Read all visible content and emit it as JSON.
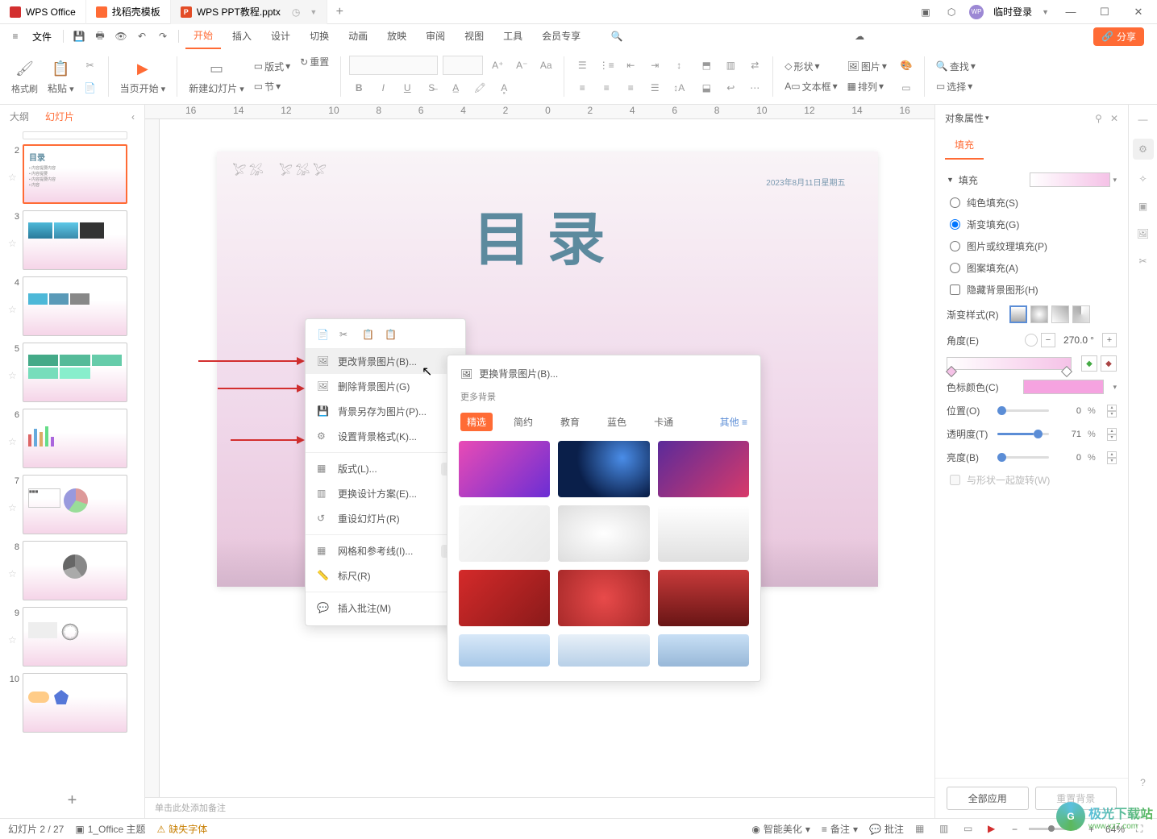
{
  "titlebar": {
    "tabs": [
      {
        "icon": "wps-logo",
        "label": "WPS Office"
      },
      {
        "icon": "doc-icon",
        "label": "找稻壳模板"
      },
      {
        "icon": "ppt-icon",
        "label": "WPS PPT教程.pptx",
        "active": true
      }
    ],
    "login": "临时登录"
  },
  "menubar": {
    "file": "文件",
    "items": [
      "开始",
      "插入",
      "设计",
      "切换",
      "动画",
      "放映",
      "审阅",
      "视图",
      "工具",
      "会员专享"
    ],
    "active": "开始",
    "share": "分享"
  },
  "toolbar": {
    "format_painter": "格式刷",
    "paste": "粘贴",
    "current_page": "当页开始",
    "new_slide": "新建幻灯片",
    "layout": "版式",
    "sections": "节",
    "reset": "重置",
    "shape": "形状",
    "textbox": "文本框",
    "picture": "图片",
    "arrange": "排列",
    "find": "查找",
    "select": "选择"
  },
  "slidepanel": {
    "tabs": {
      "outline": "大纲",
      "slides": "幻灯片"
    },
    "active": "幻灯片",
    "count": 10
  },
  "slide": {
    "title": "目录",
    "date": "2023年8月11日星期五"
  },
  "context_menu": {
    "change_bg": "更改背景图片(B)...",
    "delete_bg": "删除背景图片(G)",
    "save_bg": "背景另存为图片(P)...",
    "bg_format": "设置背景格式(K)...",
    "layout": "版式(L)...",
    "change_design": "更换设计方案(E)...",
    "reset_slide": "重设幻灯片(R)",
    "grid": "网格和参考线(I)...",
    "ruler": "标尺(R)",
    "insert_comment": "插入批注(M)"
  },
  "bg_panel": {
    "replace": "更换背景图片(B)...",
    "more": "更多背景",
    "tabs": [
      "精选",
      "简约",
      "教育",
      "蓝色",
      "卡通"
    ],
    "other": "其他",
    "active": "精选"
  },
  "ruler_ticks": [
    "16",
    "14",
    "12",
    "10",
    "8",
    "6",
    "4",
    "2",
    "0",
    "2",
    "4",
    "6",
    "8",
    "10",
    "12",
    "14",
    "16"
  ],
  "props": {
    "header": "对象属性",
    "tab": "填充",
    "section": "填充",
    "fill_types": {
      "solid": "纯色填充(S)",
      "gradient": "渐变填充(G)",
      "picture": "图片或纹理填充(P)",
      "pattern": "图案填充(A)"
    },
    "hide_bg": "隐藏背景图形(H)",
    "gradient_style": "渐变样式(R)",
    "angle": "角度(E)",
    "angle_value": "270.0",
    "angle_unit": "°",
    "color_label": "色标颜色(C)",
    "position": "位置(O)",
    "position_value": "0",
    "transparency": "透明度(T)",
    "transparency_value": "71",
    "brightness": "亮度(B)",
    "brightness_value": "0",
    "rotate_with_shape": "与形状一起旋转(W)",
    "apply_all": "全部应用",
    "reset_bg": "重置背景"
  },
  "notes": "单击此处添加备注",
  "statusbar": {
    "slide_info": "幻灯片 2 / 27",
    "theme": "1_Office 主题",
    "missing_font": "缺失字体",
    "beautify": "智能美化",
    "notes": "备注",
    "comments": "批注",
    "zoom": "64%"
  },
  "watermark": {
    "name": "极光下载站",
    "url": "www.xz7.com"
  }
}
